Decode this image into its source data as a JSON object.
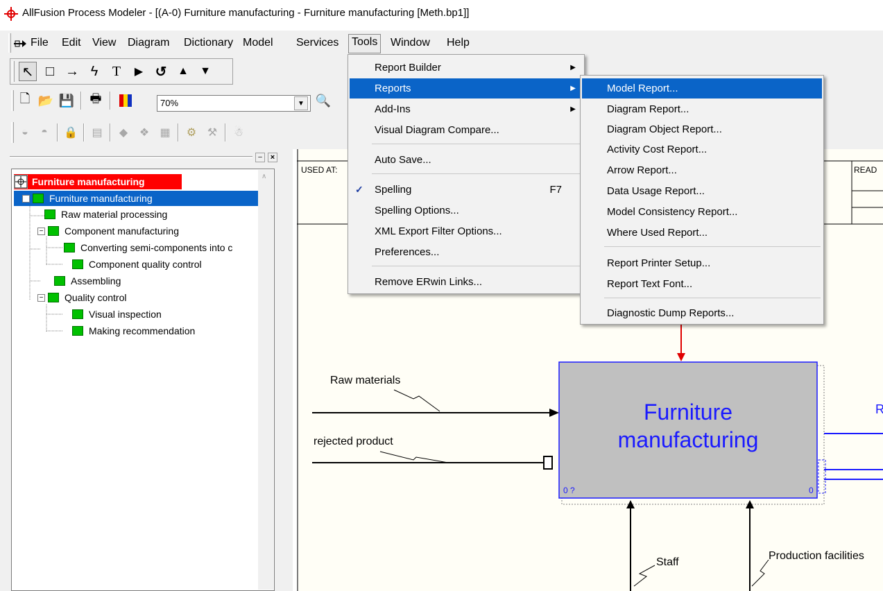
{
  "window": {
    "title": "AllFusion Process Modeler - [(A-0) Furniture manufacturing - Furniture manufacturing  [Meth.bp1]]"
  },
  "menubar": {
    "items": [
      {
        "label": "File"
      },
      {
        "label": "Edit"
      },
      {
        "label": "View"
      },
      {
        "label": "Diagram"
      },
      {
        "label": "Dictionary"
      },
      {
        "label": "Model"
      },
      {
        "label": "Services"
      },
      {
        "label": "Tools"
      },
      {
        "label": "Window"
      },
      {
        "label": "Help"
      }
    ]
  },
  "toolbar": {
    "zoom_value": "70%"
  },
  "tree": {
    "root": "Furniture manufacturing",
    "items": [
      {
        "label": "Furniture manufacturing"
      },
      {
        "label": "Raw material processing"
      },
      {
        "label": "Component manufacturing"
      },
      {
        "label": "Converting semi-components into c"
      },
      {
        "label": "Component quality control"
      },
      {
        "label": "Assembling"
      },
      {
        "label": "Quality control"
      },
      {
        "label": "Visual inspection"
      },
      {
        "label": "Making  recommendation"
      }
    ]
  },
  "canvas": {
    "used_at_label": "USED AT:",
    "reader_label": "READ",
    "activity_title_line1": "Furniture",
    "activity_title_line2": "manufacturing",
    "activity_cost_left": "0 ?",
    "activity_cost_right": "0",
    "right_edge_label": "R",
    "arrows": {
      "input1": "Raw materials",
      "input2": "rejected product",
      "mech1": "Staff",
      "mech2": "Production facilities"
    }
  },
  "tools_menu": {
    "items": [
      {
        "label": "Report Builder",
        "submenu": true
      },
      {
        "label": "Reports",
        "submenu": true
      },
      {
        "label": "Add-Ins",
        "submenu": true
      },
      {
        "label": "Visual Diagram Compare..."
      },
      {
        "label": "Auto Save..."
      },
      {
        "label": "Spelling",
        "accel": "F7"
      },
      {
        "label": "Spelling Options..."
      },
      {
        "label": "XML Export Filter Options..."
      },
      {
        "label": "Preferences..."
      },
      {
        "label": "Remove ERwin Links..."
      }
    ]
  },
  "reports_menu": {
    "items": [
      {
        "label": "Model Report..."
      },
      {
        "label": "Diagram Report..."
      },
      {
        "label": "Diagram Object Report..."
      },
      {
        "label": "Activity Cost Report..."
      },
      {
        "label": "Arrow Report..."
      },
      {
        "label": "Data Usage Report..."
      },
      {
        "label": "Model Consistency Report..."
      },
      {
        "label": "Where Used Report..."
      },
      {
        "label": "Report Printer Setup..."
      },
      {
        "label": "Report Text Font..."
      },
      {
        "label": "Diagnostic Dump Reports..."
      }
    ]
  },
  "colors": {
    "highlight": "#0a64c8",
    "activity_fill": "#c0c0c0",
    "activity_text": "#1a1aff",
    "tree_root_bg": "#ff0000",
    "tree_box": "#00c000",
    "control_arrow": "#e00000"
  }
}
